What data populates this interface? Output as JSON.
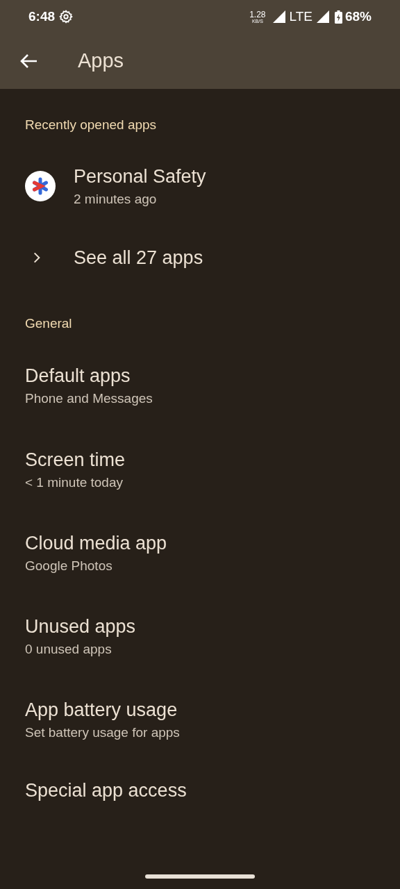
{
  "status_bar": {
    "time": "6:48",
    "speed": "1.28",
    "speed_unit": "KB/S",
    "network": "LTE",
    "battery": "68%"
  },
  "app_bar": {
    "title": "Apps"
  },
  "sections": [
    {
      "header": "Recently opened apps",
      "items": [
        {
          "kind": "app",
          "title": "Personal Safety",
          "subtitle": "2 minutes ago"
        },
        {
          "kind": "link",
          "title": "See all 27 apps"
        }
      ]
    },
    {
      "header": "General",
      "items": [
        {
          "kind": "setting",
          "title": "Default apps",
          "subtitle": "Phone and Messages"
        },
        {
          "kind": "setting",
          "title": "Screen time",
          "subtitle": "< 1 minute today"
        },
        {
          "kind": "setting",
          "title": "Cloud media app",
          "subtitle": "Google Photos"
        },
        {
          "kind": "setting",
          "title": "Unused apps",
          "subtitle": "0 unused apps"
        },
        {
          "kind": "setting",
          "title": "App battery usage",
          "subtitle": "Set battery usage for apps"
        },
        {
          "kind": "setting",
          "title": "Special app access"
        }
      ]
    }
  ]
}
